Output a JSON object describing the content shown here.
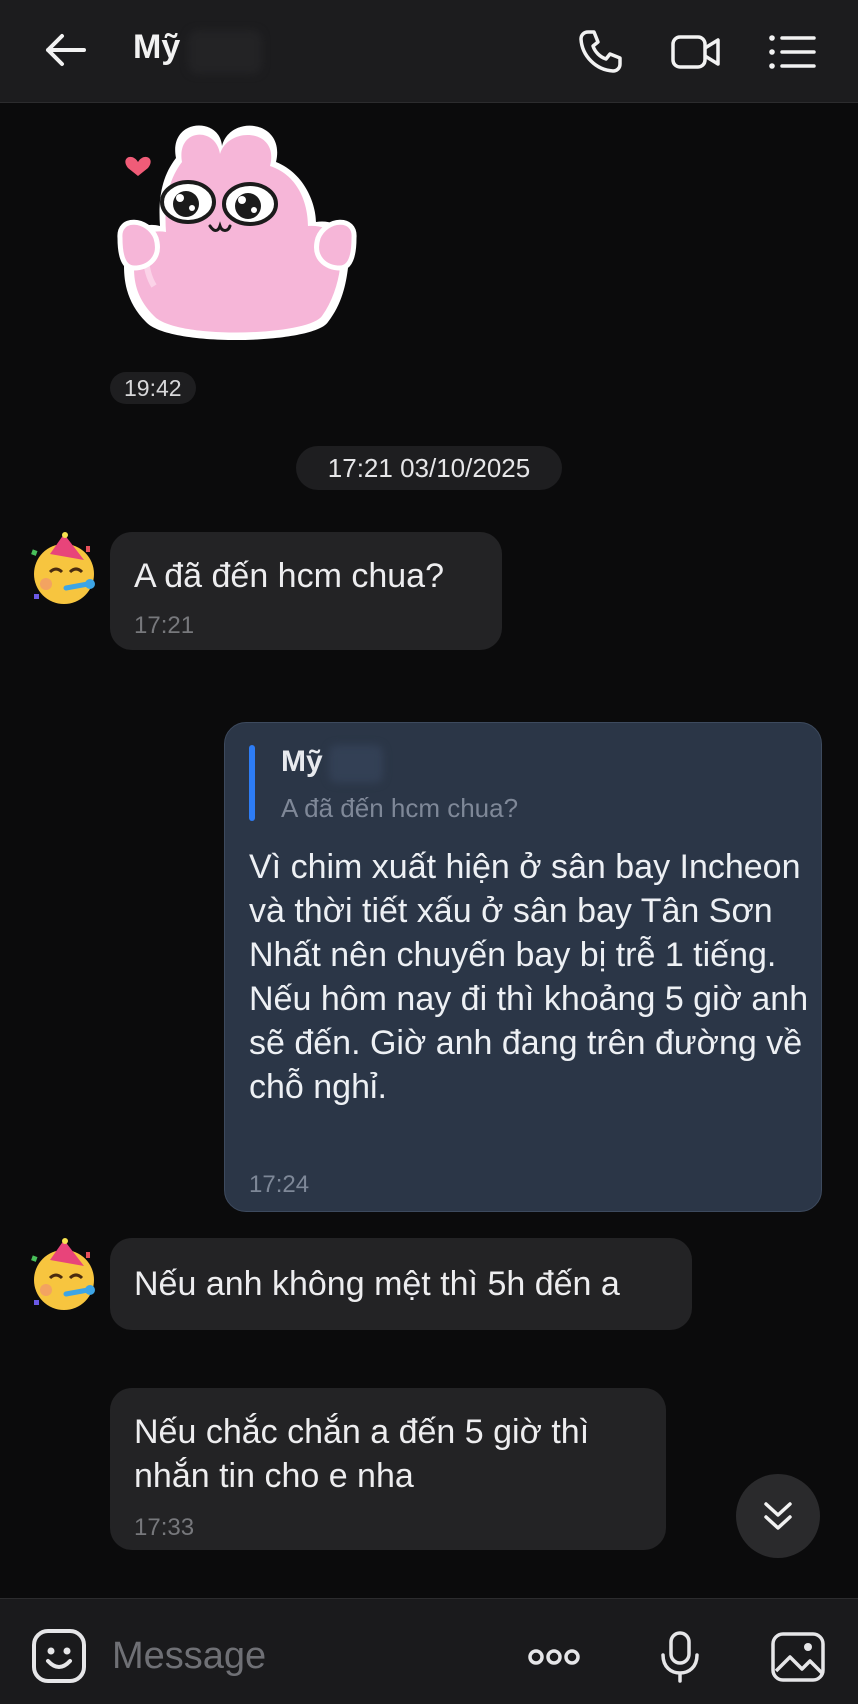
{
  "header": {
    "contact_name": "Mỹ"
  },
  "sticker": {
    "time": "19:42"
  },
  "date_divider": "17:21 03/10/2025",
  "messages": [
    {
      "text": "A đã đến hcm chua?",
      "time": "17:21"
    },
    {
      "reply": {
        "quoted_name": "Mỹ",
        "quoted_text": "A đã đến hcm chua?"
      },
      "text": "Vì chim xuất hiện ở sân bay Incheon và thời tiết xấu ở sân bay Tân Sơn Nhất nên chuyến bay bị trễ 1 tiếng. Nếu hôm nay đi thì khoảng 5 giờ anh sẽ đến. Giờ anh đang trên đường về chỗ nghỉ.",
      "time": "17:24"
    },
    {
      "text": "Nếu anh không mệt thì 5h đến a"
    },
    {
      "text": "Nếu chắc chắn a đến 5 giờ thì nhắn tin cho e nha",
      "time": "17:33"
    }
  ],
  "composer": {
    "placeholder": "Message"
  },
  "colors": {
    "accent": "#2d7cf5",
    "outgoing_bubble": "#2b3647",
    "incoming_bubble": "#232325",
    "sticker_pink": "#f6b6d8"
  },
  "icons": [
    "back-arrow-icon",
    "phone-icon",
    "video-icon",
    "menu-list-icon",
    "emoji-icon",
    "more-dots-icon",
    "microphone-icon",
    "gallery-icon",
    "scroll-down-icon"
  ]
}
